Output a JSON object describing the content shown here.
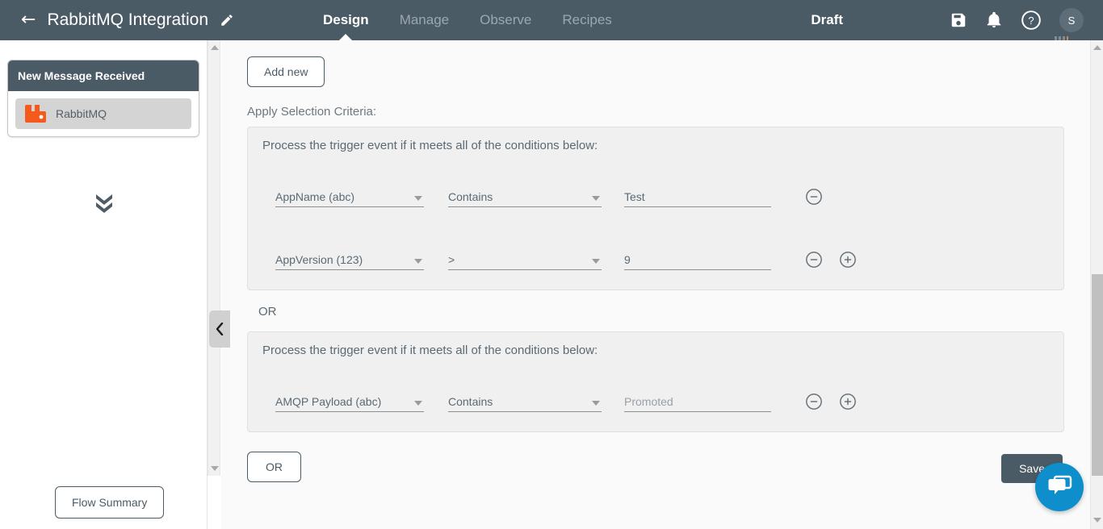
{
  "header": {
    "back_icon": "back-arrow-icon",
    "flow_title": "RabbitMQ Integration",
    "edit_icon": "pencil-icon",
    "tabs": [
      {
        "label": "Design",
        "active": true
      },
      {
        "label": "Manage",
        "active": false
      },
      {
        "label": "Observe",
        "active": false
      },
      {
        "label": "Recipes",
        "active": false
      }
    ],
    "status": "Draft",
    "icons": [
      "save-floppy-icon",
      "bell-icon",
      "help-circle-icon"
    ],
    "avatar_initial": "S",
    "bg_color": "#4b5b66"
  },
  "left_panel": {
    "node_card": {
      "title": "New Message Received",
      "item_label": "RabbitMQ",
      "item_icon": "rabbitmq-logo-icon",
      "icon_color": "#f6591c"
    },
    "expand_icon": "double-chevron-down-icon",
    "flow_summary_label": "Flow Summary",
    "collapse_icon": "chevron-left-icon"
  },
  "main": {
    "add_new_label": "Add new",
    "selection_criteria_label": "Apply Selection Criteria:",
    "criteria_groups": [
      {
        "title": "Process the trigger event if it meets all of the conditions below:",
        "rows": [
          {
            "attribute": "AppName  (abc)",
            "operator": "Contains",
            "value": "Test",
            "value_is_placeholder": false,
            "has_remove": true,
            "has_add": false
          },
          {
            "attribute": "AppVersion (123)",
            "operator": ">",
            "value": "9",
            "value_is_placeholder": false,
            "has_remove": true,
            "has_add": true
          }
        ]
      },
      {
        "title": "Process the trigger event if it meets all of the conditions below:",
        "rows": [
          {
            "attribute": "AMQP Payload  (abc)",
            "operator": "Contains",
            "value": "Promoted",
            "value_is_placeholder": true,
            "has_remove": true,
            "has_add": true
          }
        ]
      }
    ],
    "or_separator_label": "OR",
    "or_button_label": "OR",
    "save_label": "Save"
  },
  "chat": {
    "icon": "chat-bubbles-icon",
    "color": "#0e8fcc"
  },
  "misc": {
    "bars_icon": "vertical-bars-icon"
  }
}
